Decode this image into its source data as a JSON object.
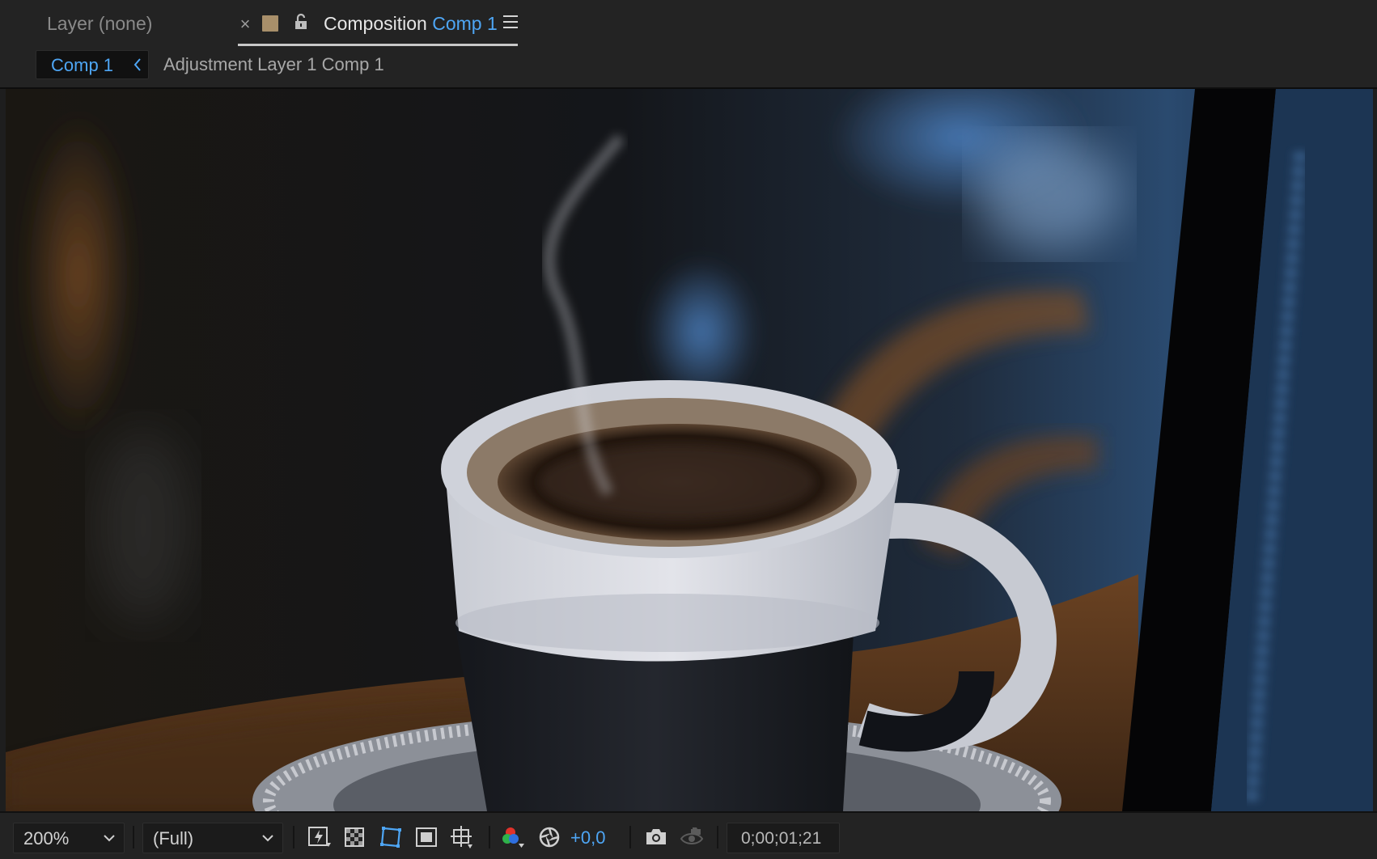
{
  "tabs": {
    "layer_tab_label": "Layer (none)",
    "composition_prefix": "Composition",
    "composition_name": "Comp 1",
    "close_glyph": "×",
    "label_color": "#a88f6a"
  },
  "breadcrumb": {
    "active": "Comp 1",
    "next": "Adjustment Layer 1 Comp 1"
  },
  "toolbar": {
    "magnification": "200%",
    "resolution": "(Full)",
    "exposure": "+0,0",
    "timecode": "0;00;01;21"
  },
  "icons": {
    "lock": "lock-icon",
    "menu": "hamburger-menu-icon",
    "fast_previews": "fast-previews-icon",
    "transparency_grid": "transparency-grid-icon",
    "mask_visibility": "mask-path-visibility-icon",
    "region_of_interest": "region-of-interest-icon",
    "grid_guides": "grid-guides-icon",
    "channels": "rgb-channels-icon",
    "color_management": "color-management-icon",
    "snapshot": "camera-icon",
    "show_snapshot": "show-snapshot-icon"
  },
  "colors": {
    "accent_blue": "#4ea6f5",
    "panel_bg": "#232323"
  }
}
